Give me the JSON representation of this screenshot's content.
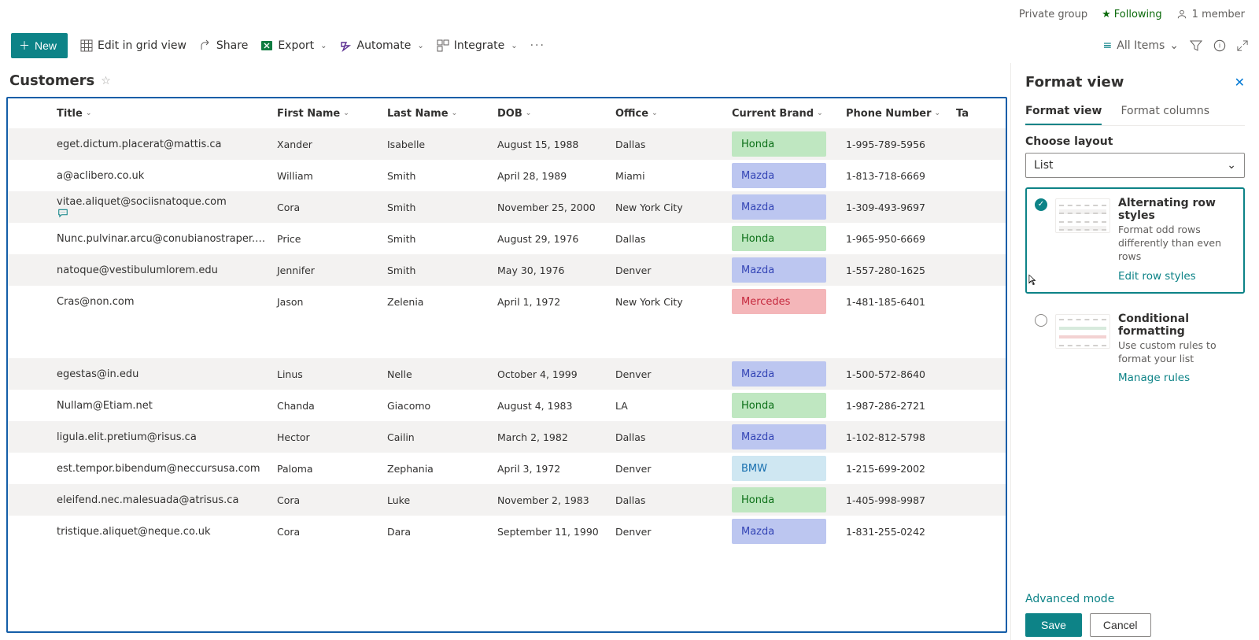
{
  "context": {
    "privacy": "Private group",
    "following": "Following",
    "members": "1 member"
  },
  "commands": {
    "new": "New",
    "editGrid": "Edit in grid view",
    "share": "Share",
    "export": "Export",
    "automate": "Automate",
    "integrate": "Integrate",
    "viewName": "All Items"
  },
  "listTitle": "Customers",
  "columns": [
    "Title",
    "First Name",
    "Last Name",
    "DOB",
    "Office",
    "Current Brand",
    "Phone Number",
    "Ta"
  ],
  "rows": [
    {
      "title": "eget.dictum.placerat@mattis.ca",
      "first": "Xander",
      "last": "Isabelle",
      "dob": "August 15, 1988",
      "office": "Dallas",
      "brand": "Honda",
      "phone": "1-995-789-5956",
      "alt": true
    },
    {
      "title": "a@aclibero.co.uk",
      "first": "William",
      "last": "Smith",
      "dob": "April 28, 1989",
      "office": "Miami",
      "brand": "Mazda",
      "phone": "1-813-718-6669",
      "alt": false
    },
    {
      "title": "vitae.aliquet@sociisnatoque.com",
      "first": "Cora",
      "last": "Smith",
      "dob": "November 25, 2000",
      "office": "New York City",
      "brand": "Mazda",
      "phone": "1-309-493-9697",
      "alt": true,
      "hasComment": true
    },
    {
      "title": "Nunc.pulvinar.arcu@conubianostraper.edu",
      "first": "Price",
      "last": "Smith",
      "dob": "August 29, 1976",
      "office": "Dallas",
      "brand": "Honda",
      "phone": "1-965-950-6669",
      "alt": false
    },
    {
      "title": "natoque@vestibulumlorem.edu",
      "first": "Jennifer",
      "last": "Smith",
      "dob": "May 30, 1976",
      "office": "Denver",
      "brand": "Mazda",
      "phone": "1-557-280-1625",
      "alt": true
    },
    {
      "title": "Cras@non.com",
      "first": "Jason",
      "last": "Zelenia",
      "dob": "April 1, 1972",
      "office": "New York City",
      "brand": "Mercedes",
      "phone": "1-481-185-6401",
      "alt": false
    }
  ],
  "rows2": [
    {
      "title": "egestas@in.edu",
      "first": "Linus",
      "last": "Nelle",
      "dob": "October 4, 1999",
      "office": "Denver",
      "brand": "Mazda",
      "phone": "1-500-572-8640",
      "alt": true
    },
    {
      "title": "Nullam@Etiam.net",
      "first": "Chanda",
      "last": "Giacomo",
      "dob": "August 4, 1983",
      "office": "LA",
      "brand": "Honda",
      "phone": "1-987-286-2721",
      "alt": false
    },
    {
      "title": "ligula.elit.pretium@risus.ca",
      "first": "Hector",
      "last": "Cailin",
      "dob": "March 2, 1982",
      "office": "Dallas",
      "brand": "Mazda",
      "phone": "1-102-812-5798",
      "alt": true
    },
    {
      "title": "est.tempor.bibendum@neccursusa.com",
      "first": "Paloma",
      "last": "Zephania",
      "dob": "April 3, 1972",
      "office": "Denver",
      "brand": "BMW",
      "phone": "1-215-699-2002",
      "alt": false
    },
    {
      "title": "eleifend.nec.malesuada@atrisus.ca",
      "first": "Cora",
      "last": "Luke",
      "dob": "November 2, 1983",
      "office": "Dallas",
      "brand": "Honda",
      "phone": "1-405-998-9987",
      "alt": true
    },
    {
      "title": "tristique.aliquet@neque.co.uk",
      "first": "Cora",
      "last": "Dara",
      "dob": "September 11, 1990",
      "office": "Denver",
      "brand": "Mazda",
      "phone": "1-831-255-0242",
      "alt": false
    }
  ],
  "brandClass": {
    "Honda": "brand-honda",
    "Mazda": "brand-mazda",
    "Mercedes": "brand-mercedes",
    "BMW": "brand-bmw"
  },
  "panel": {
    "title": "Format view",
    "tabs": [
      "Format view",
      "Format columns"
    ],
    "chooseLayout": "Choose layout",
    "layoutValue": "List",
    "opt1": {
      "title": "Alternating row styles",
      "desc": "Format odd rows differently than even rows",
      "link": "Edit row styles"
    },
    "opt2": {
      "title": "Conditional formatting",
      "desc": "Use custom rules to format your list",
      "link": "Manage rules"
    },
    "advanced": "Advanced mode",
    "save": "Save",
    "cancel": "Cancel"
  }
}
